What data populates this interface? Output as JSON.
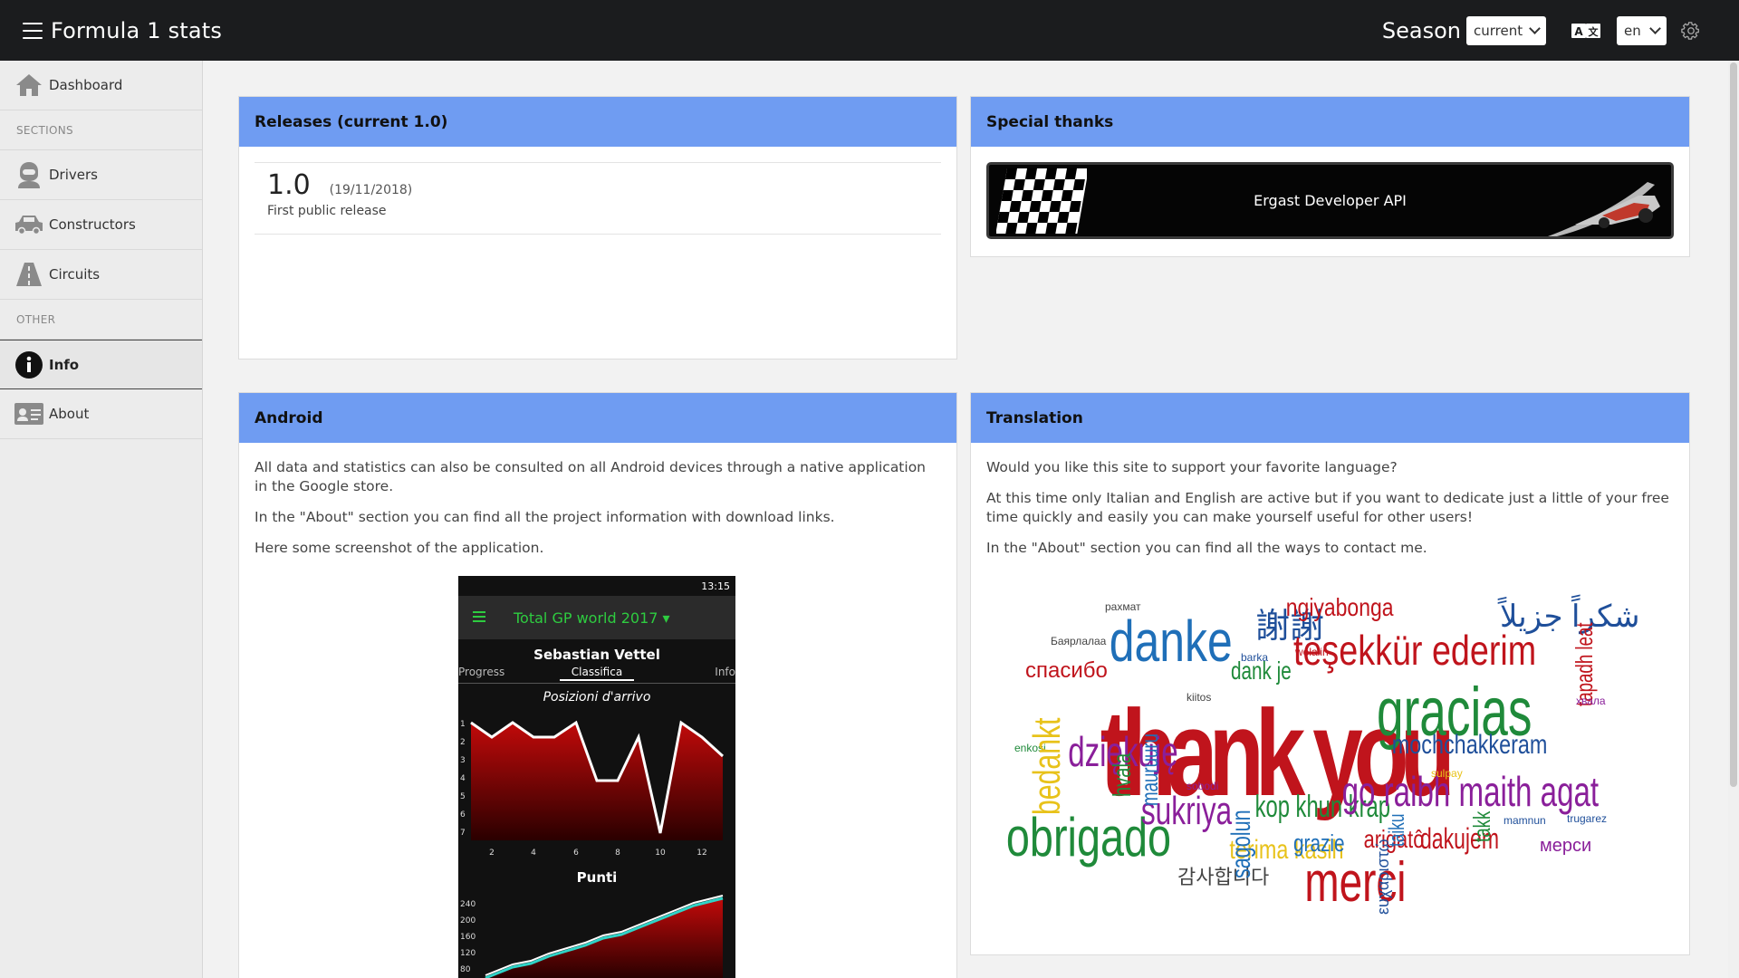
{
  "header": {
    "title": "Formula 1 stats",
    "season_label": "Season",
    "season_value": "current",
    "language_value": "en"
  },
  "sidebar": {
    "items": [
      {
        "label": "Dashboard",
        "icon": "home-icon"
      },
      {
        "section": "SECTIONS"
      },
      {
        "label": "Drivers",
        "icon": "driver-icon"
      },
      {
        "label": "Constructors",
        "icon": "car-icon"
      },
      {
        "label": "Circuits",
        "icon": "road-icon"
      },
      {
        "section": "OTHER"
      },
      {
        "label": "Info",
        "icon": "info-icon",
        "active": true
      },
      {
        "label": "About",
        "icon": "id-card-icon"
      }
    ],
    "dashboard": "Dashboard",
    "sections": "SECTIONS",
    "drivers": "Drivers",
    "constructors": "Constructors",
    "circuits": "Circuits",
    "other": "OTHER",
    "info": "Info",
    "about": "About"
  },
  "releases": {
    "title": "Releases (current 1.0)",
    "version": "1.0",
    "date": "(19/11/2018)",
    "description": "First public release"
  },
  "thanks": {
    "title": "Special thanks",
    "banner_label": "Ergast Developer API"
  },
  "android": {
    "title": "Android",
    "p1": "All data and statistics can also be consulted on all Android devices through a native application in the Google store.",
    "p2": "In the \"About\" section you can find all the project information with download links.",
    "p3": "Here some screenshot of the application.",
    "screenshot": {
      "time": "13:15",
      "app_title": "Total GP world 2017 ▾",
      "driver": "Sebastian Vettel",
      "tabs": [
        "Progress",
        "Classifica",
        "Info"
      ],
      "chart1_title": "Posizioni d'arrivo",
      "chart2_title": "Punti"
    }
  },
  "translation": {
    "title": "Translation",
    "p1": "Would you like this site to support your favorite language?",
    "p2": "At this time only Italian and English are active but if you want to dedicate just a little of your free time quickly and easily you can make yourself useful for other users!",
    "p3": "In the \"About\" section you can find all the ways to contact me."
  },
  "colors": {
    "header_bg": "#1b1c1e",
    "card_header": "#6f9cf2",
    "sidebar_bg": "#ececec"
  }
}
